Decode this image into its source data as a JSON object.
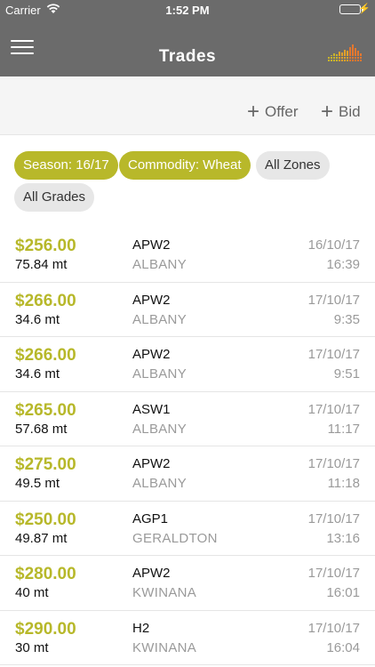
{
  "status_bar": {
    "carrier": "Carrier",
    "time": "1:52 PM"
  },
  "header": {
    "title": "Trades"
  },
  "actions": {
    "offer": "Offer",
    "bid": "Bid"
  },
  "filters": [
    {
      "label": "Season: 16/17",
      "active": true
    },
    {
      "label": "Commodity: Wheat",
      "active": true
    },
    {
      "label": "All Zones",
      "active": false
    },
    {
      "label": "All Grades",
      "active": false
    }
  ],
  "colors": {
    "accent": "#b8b82a",
    "header": "#6b6b6b",
    "muted": "#9a9a9a"
  },
  "trades": [
    {
      "price": "$256.00",
      "quantity": "75.84 mt",
      "grade": "APW2",
      "zone": "ALBANY",
      "date": "16/10/17",
      "time": "16:39"
    },
    {
      "price": "$266.00",
      "quantity": "34.6 mt",
      "grade": "APW2",
      "zone": "ALBANY",
      "date": "17/10/17",
      "time": "9:35"
    },
    {
      "price": "$266.00",
      "quantity": "34.6 mt",
      "grade": "APW2",
      "zone": "ALBANY",
      "date": "17/10/17",
      "time": "9:51"
    },
    {
      "price": "$265.00",
      "quantity": "57.68 mt",
      "grade": "ASW1",
      "zone": "ALBANY",
      "date": "17/10/17",
      "time": "11:17"
    },
    {
      "price": "$275.00",
      "quantity": "49.5 mt",
      "grade": "APW2",
      "zone": "ALBANY",
      "date": "17/10/17",
      "time": "11:18"
    },
    {
      "price": "$250.00",
      "quantity": "49.87 mt",
      "grade": "AGP1",
      "zone": "GERALDTON",
      "date": "17/10/17",
      "time": "13:16"
    },
    {
      "price": "$280.00",
      "quantity": "40 mt",
      "grade": "APW2",
      "zone": "KWINANA",
      "date": "17/10/17",
      "time": "16:01"
    },
    {
      "price": "$290.00",
      "quantity": "30 mt",
      "grade": "H2",
      "zone": "KWINANA",
      "date": "17/10/17",
      "time": "16:04"
    }
  ]
}
